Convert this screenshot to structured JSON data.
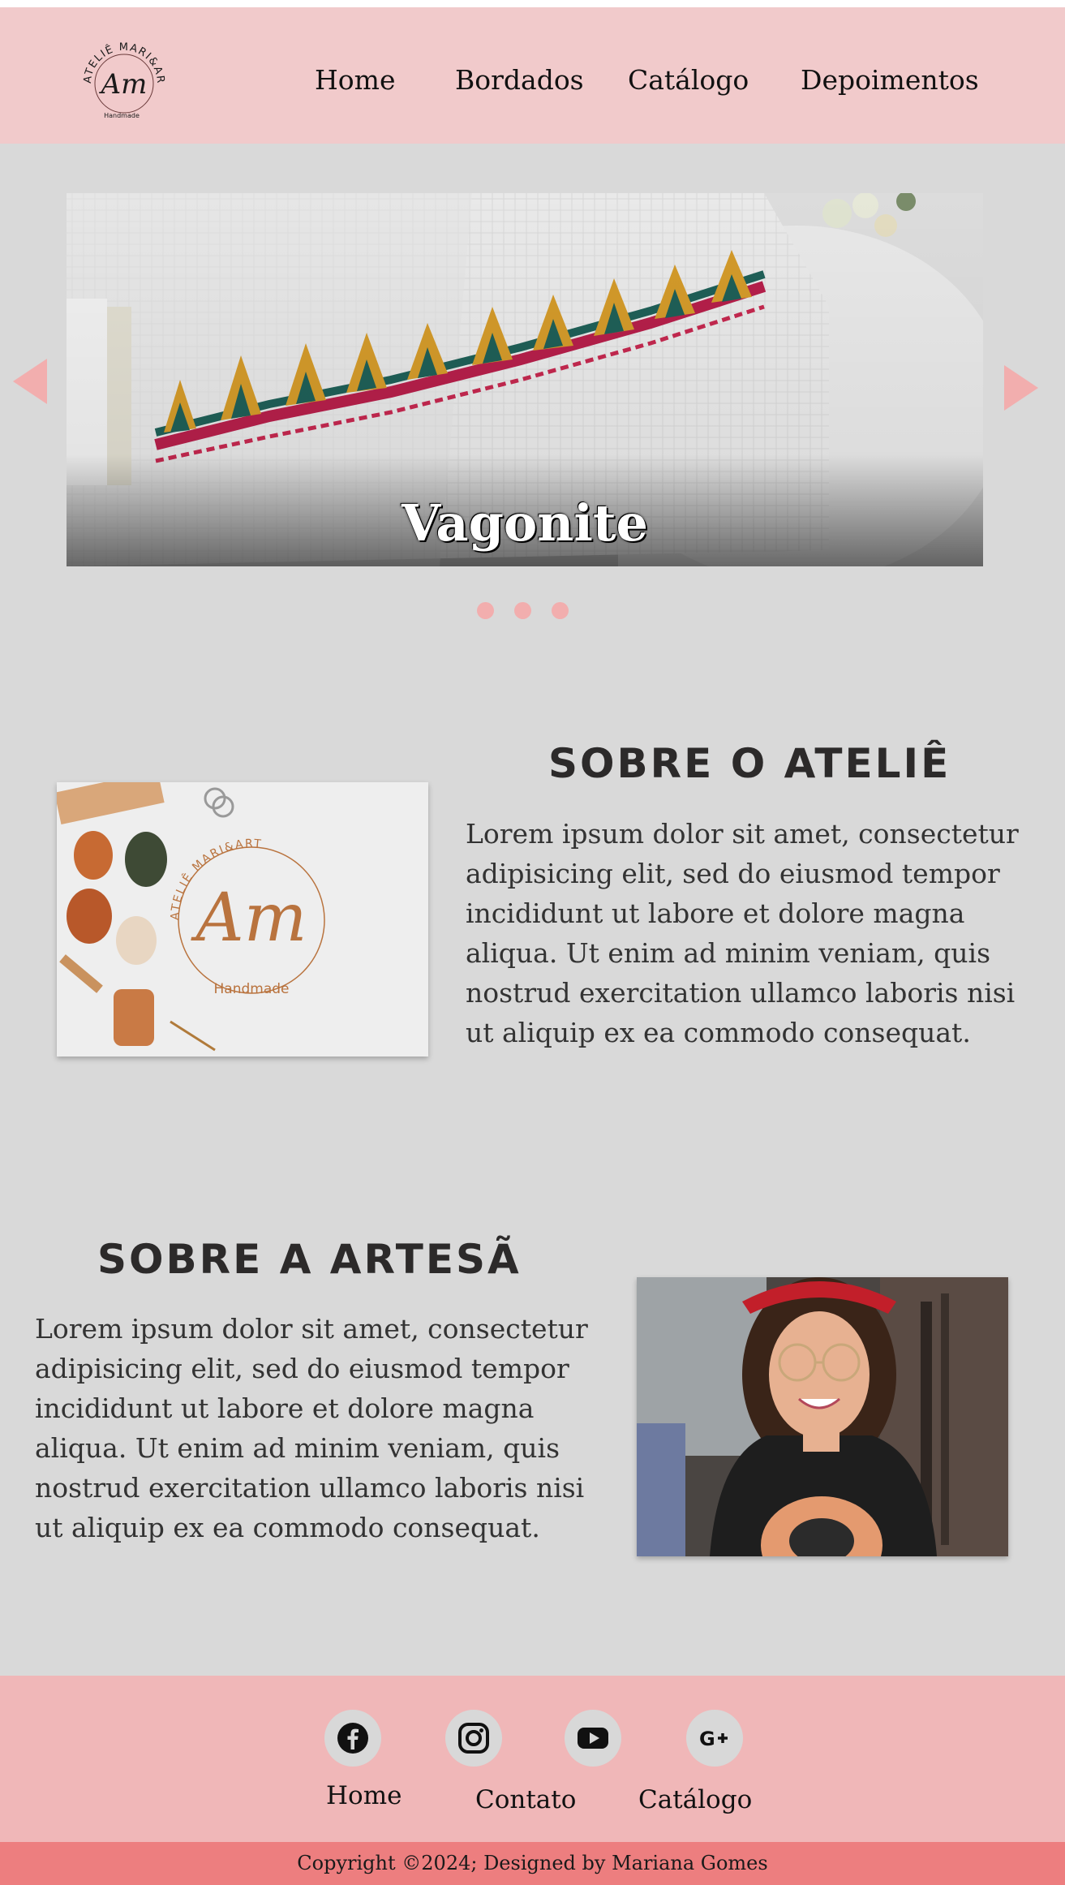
{
  "header": {
    "logo": {
      "icon": "atelie-logo-icon",
      "text_top": "ATELIÊ MARI&ART",
      "monogram": "Am",
      "text_bottom": "Handmade"
    },
    "nav": [
      {
        "label": "Home"
      },
      {
        "label": "Bordados"
      },
      {
        "label": "Catálogo"
      },
      {
        "label": "Depoimentos"
      }
    ]
  },
  "carousel": {
    "caption": "Vagonite",
    "prev_icon": "triangle-left-icon",
    "next_icon": "triangle-right-icon",
    "dots_count": 3,
    "accent_color": "#f2aeae"
  },
  "about_atelie": {
    "title": "SOBRE O ATELIÊ",
    "text": "Lorem ipsum dolor sit amet, consectetur adipisicing elit, sed do eiusmod tempor incididunt ut labore et dolore magna aliqua. Ut enim ad minim veniam, quis nostrud exercitation ullamco laboris nisi ut aliquip ex ea commodo consequat.",
    "image": {
      "text_top": "ATELIÊ MARI&ART",
      "monogram": "Am",
      "text_bottom": "Handmade"
    }
  },
  "about_artesa": {
    "title": "SOBRE A ARTESÃ",
    "text": "Lorem ipsum dolor sit amet, consectetur adipisicing elit, sed do eiusmod tempor incididunt ut labore et dolore magna aliqua. Ut enim ad minim veniam, quis nostrud exercitation ullamco laboris nisi ut aliquip ex ea commodo consequat."
  },
  "footer": {
    "social": [
      {
        "icon": "facebook-icon"
      },
      {
        "icon": "instagram-icon"
      },
      {
        "icon": "youtube-icon"
      },
      {
        "icon": "google-plus-icon"
      }
    ],
    "links": [
      {
        "label": "Home"
      },
      {
        "label": "Contato"
      },
      {
        "label": "Catálogo"
      }
    ],
    "copyright": "Copyright ©2024; Designed by Mariana Gomes"
  },
  "colors": {
    "header_bg": "#f1cacb",
    "page_bg": "#d9d9d9",
    "footer_bg": "#f0b7b8",
    "copyright_bg": "#ed7e7f"
  }
}
